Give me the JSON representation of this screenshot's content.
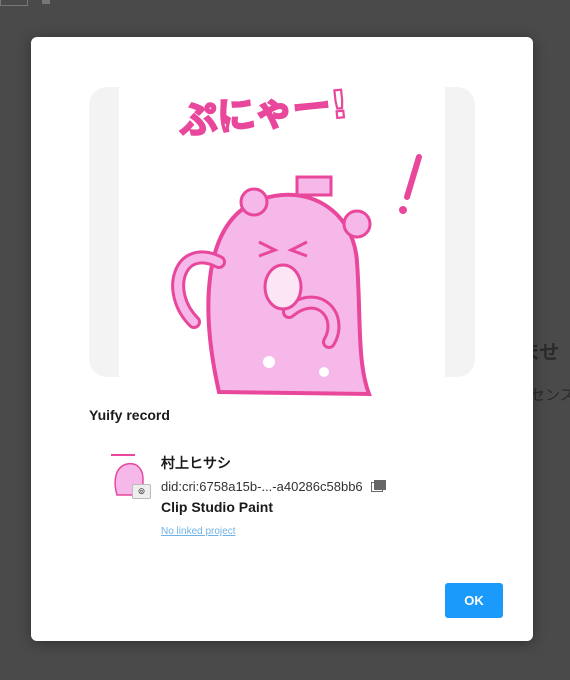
{
  "background": {
    "heading_fragment": "ませ",
    "sub_fragment": "センス"
  },
  "dialog": {
    "artwork": {
      "caption_text": "ぷにゃー!",
      "colors": {
        "pink": "#e8479b",
        "fill": "#f5b8e8",
        "light": "#fce6f6"
      }
    },
    "section_title": "Yuify record",
    "record": {
      "author": "村上ヒサシ",
      "did": "did:cri:6758a15b-...-a40286c58bb6",
      "copy_icon": "copy-icon",
      "app": "Clip Studio Paint",
      "link": "No linked project",
      "badge_icon": "eye-icon"
    },
    "ok_label": "OK"
  }
}
